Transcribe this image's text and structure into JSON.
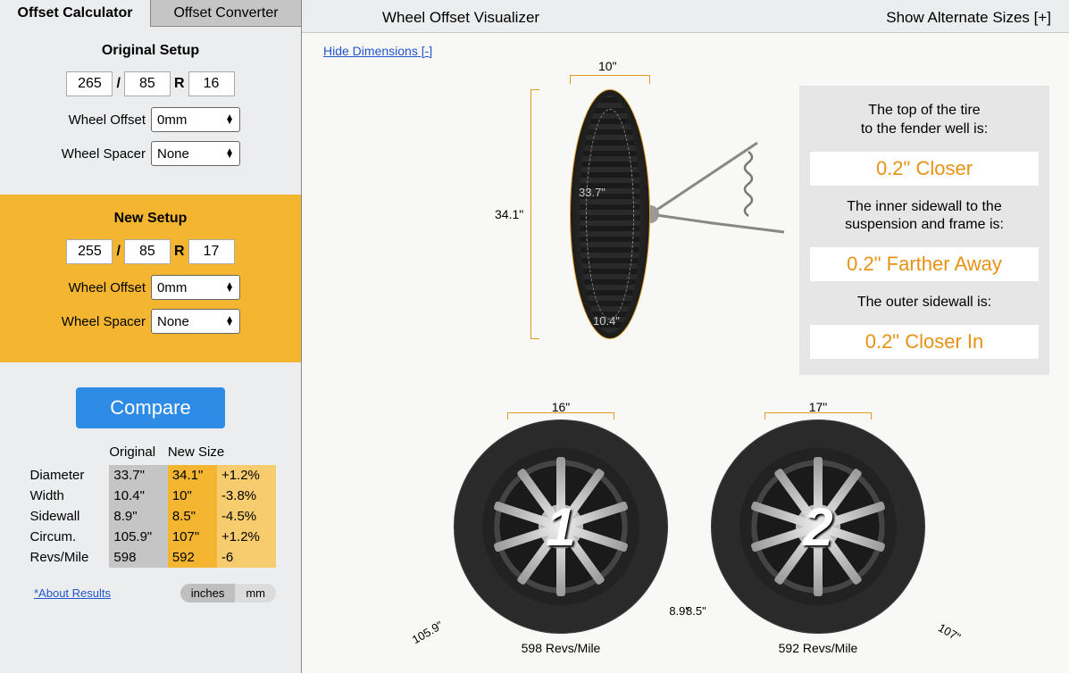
{
  "tabs": {
    "calculator": "Offset Calculator",
    "converter": "Offset Converter"
  },
  "original": {
    "title": "Original Setup",
    "width": "265",
    "aspect": "85",
    "rim": "16",
    "offset_label": "Wheel Offset",
    "offset_value": "0mm",
    "spacer_label": "Wheel Spacer",
    "spacer_value": "None"
  },
  "new": {
    "title": "New Setup",
    "width": "255",
    "aspect": "85",
    "rim": "17",
    "offset_label": "Wheel Offset",
    "offset_value": "0mm",
    "spacer_label": "Wheel Spacer",
    "spacer_value": "None"
  },
  "sep": {
    "slash": "/",
    "r": "R"
  },
  "compare": "Compare",
  "results": {
    "headers": {
      "orig": "Original",
      "new": "New Size"
    },
    "rows": [
      {
        "label": "Diameter",
        "orig": "33.7\"",
        "new": "34.1\"",
        "diff": "+1.2%"
      },
      {
        "label": "Width",
        "orig": "10.4\"",
        "new": "10\"",
        "diff": "-3.8%"
      },
      {
        "label": "Sidewall",
        "orig": "8.9\"",
        "new": "8.5\"",
        "diff": "-4.5%"
      },
      {
        "label": "Circum.",
        "orig": "105.9\"",
        "new": "107\"",
        "diff": "+1.2%"
      },
      {
        "label": "Revs/Mile",
        "orig": "598",
        "new": "592",
        "diff": "-6"
      }
    ]
  },
  "about": "*About Results",
  "units": {
    "in": "inches",
    "mm": "mm"
  },
  "right": {
    "title": "Wheel Offset Visualizer",
    "alt": "Show Alternate Sizes [+]",
    "hide": "Hide Dimensions [-]"
  },
  "side_view": {
    "width": "10\"",
    "height": "34.1\"",
    "inner": "33.7\"",
    "section": "10.4\""
  },
  "cards": [
    {
      "label1": "The top of the tire",
      "label2": "to the fender well is:",
      "value": "0.2\" Closer"
    },
    {
      "label1": "The inner sidewall to the",
      "label2": "suspension and frame is:",
      "value": "0.2\" Farther Away"
    },
    {
      "label1": "The outer sidewall is:",
      "label2": "",
      "value": "0.2\" Closer In"
    }
  ],
  "wheels": [
    {
      "num": "1",
      "rim": "16\"",
      "revs": "598 Revs/Mile",
      "circ": "105.9\"",
      "sidewall": "8.9\""
    },
    {
      "num": "2",
      "rim": "17\"",
      "revs": "592 Revs/Mile",
      "circ": "107\"",
      "sidewall": "8.5\""
    }
  ]
}
